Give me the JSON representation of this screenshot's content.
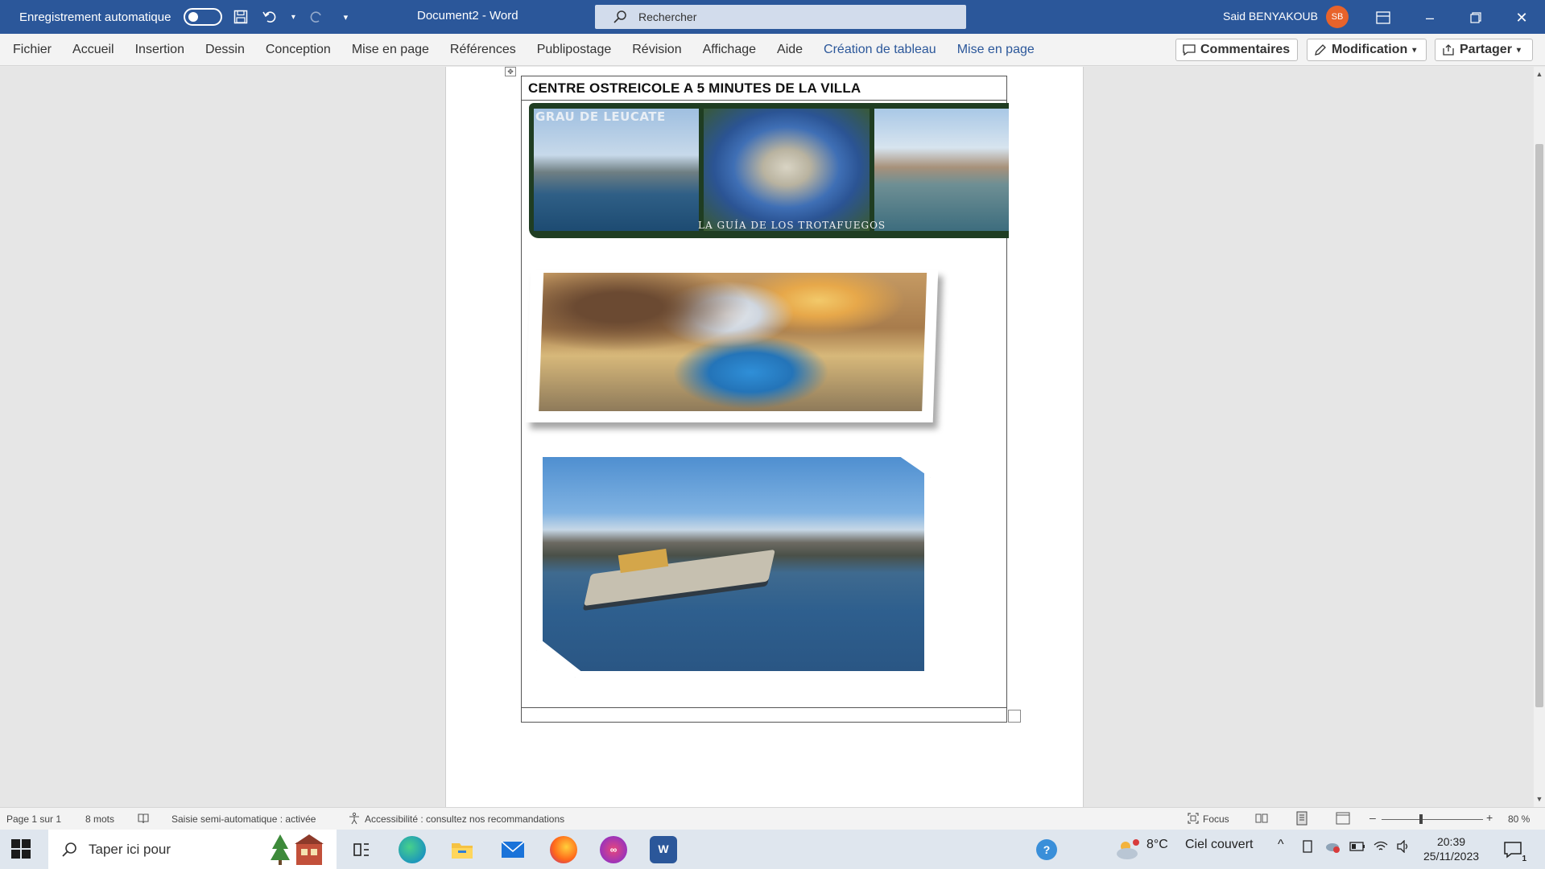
{
  "titlebar": {
    "autosave_label": "Enregistrement automatique",
    "document_title": "Document2  -  Word",
    "search_placeholder": "Rechercher",
    "user_name": "Said BENYAKOUB",
    "user_initials": "SB"
  },
  "ribbon": {
    "tabs": [
      "Fichier",
      "Accueil",
      "Insertion",
      "Dessin",
      "Conception",
      "Mise en page",
      "Références",
      "Publipostage",
      "Révision",
      "Affichage",
      "Aide"
    ],
    "context_tabs": [
      "Création de tableau",
      "Mise en page"
    ],
    "comments_label": "Commentaires",
    "editing_label": "Modification",
    "share_label": "Partager"
  },
  "document": {
    "table_title": "CENTRE OSTREICOLE A 5 MINUTES DE LA VILLA",
    "collage_caption_top": "GRAU DE LEUCATE",
    "collage_caption_bottom": "LA GUÍA DE LOS TROTAFUEGOS"
  },
  "statusbar": {
    "page_info": "Page 1 sur 1",
    "word_count": "8 mots",
    "autocomplete": "Saisie semi-automatique : activée",
    "accessibility": "Accessibilité : consultez nos recommandations",
    "focus_label": "Focus",
    "zoom_level": "80 %",
    "zoom_fraction": 0.8
  },
  "taskbar": {
    "search_placeholder": "Taper ici pour",
    "weather_temp": "8°C",
    "weather_desc": "Ciel couvert",
    "time": "20:39",
    "date": "25/11/2023",
    "notification_count": "1"
  },
  "colors": {
    "word_blue": "#2b579a",
    "avatar_orange": "#e8632b",
    "context_tab_blue": "#2b579a"
  }
}
